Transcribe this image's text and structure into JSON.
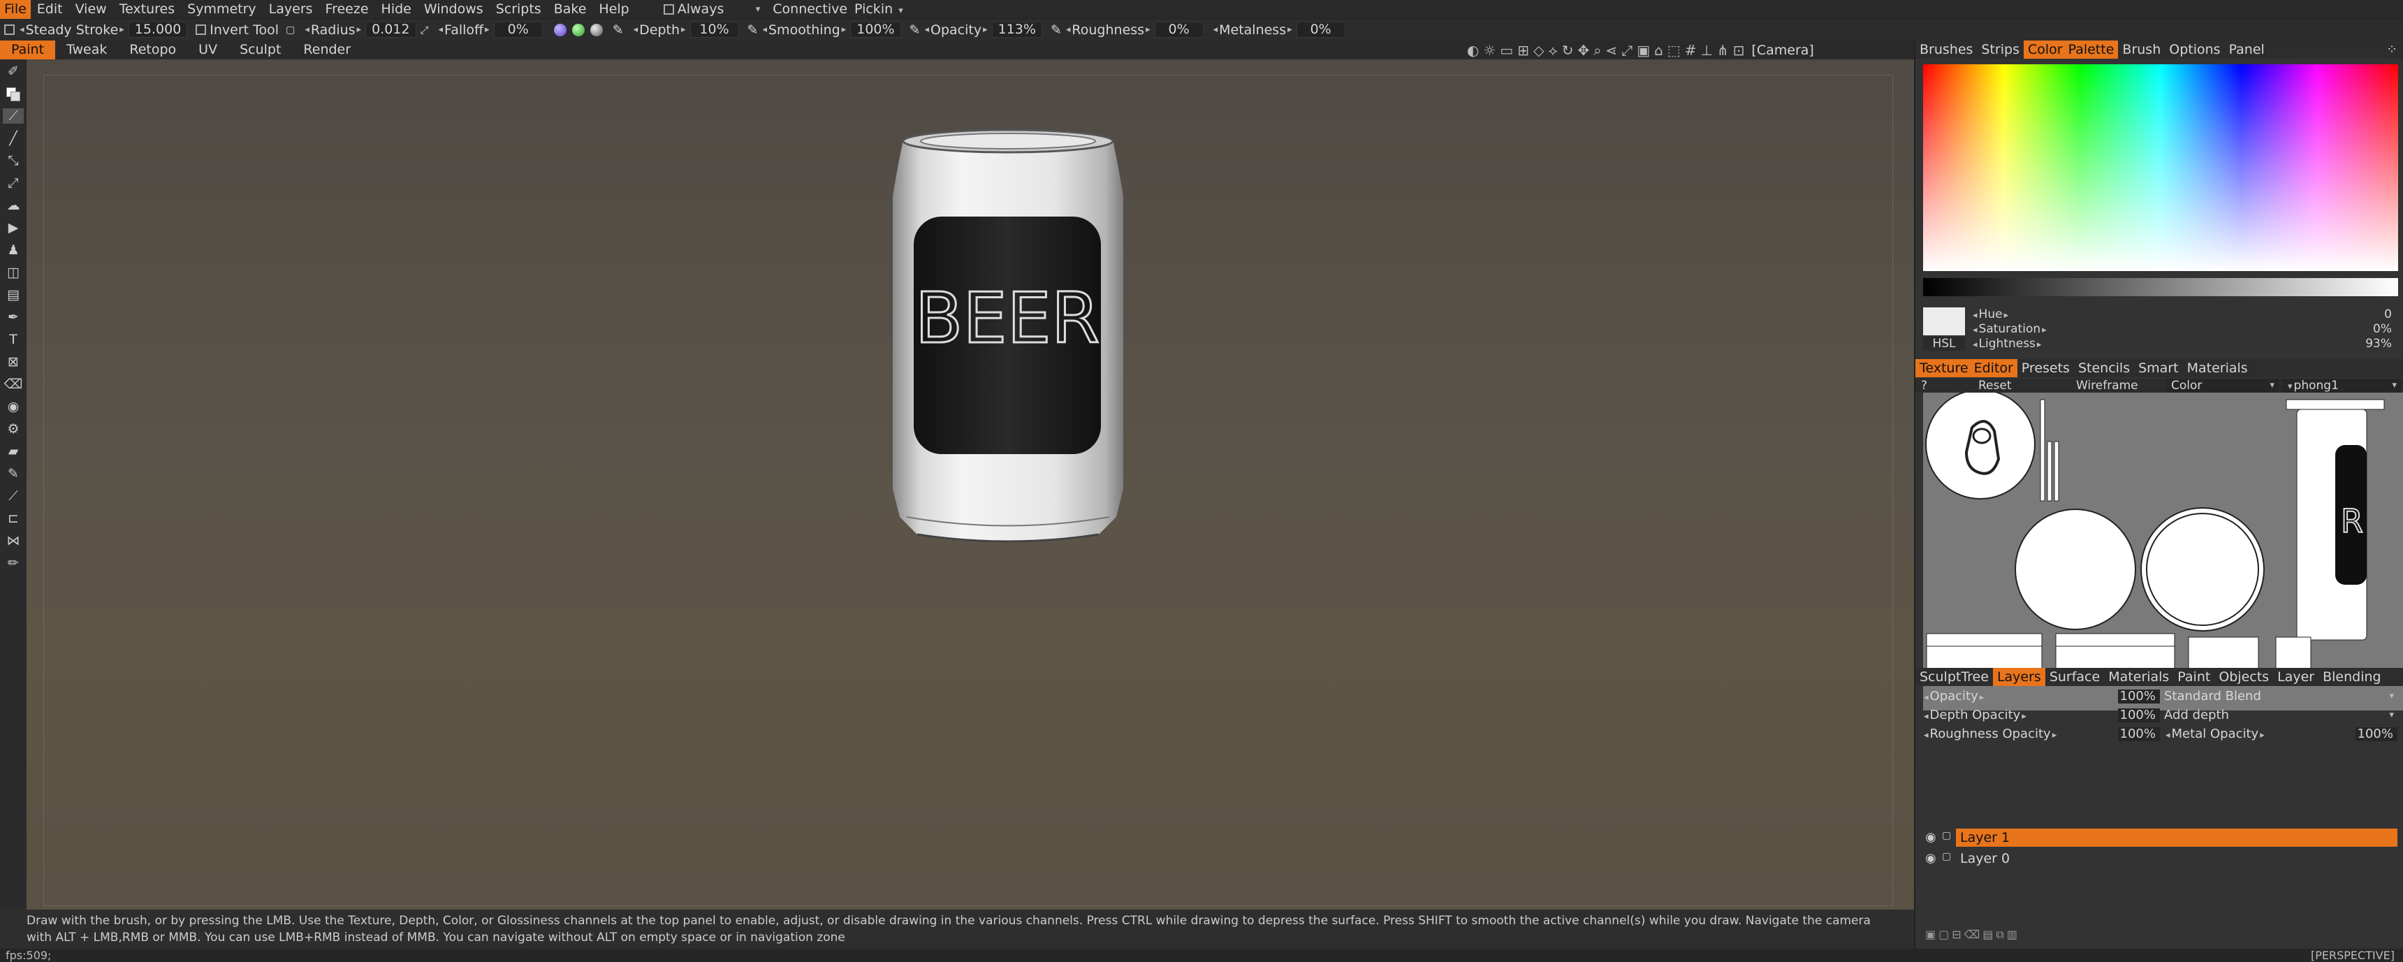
{
  "menubar": {
    "items": [
      "File",
      "Edit",
      "View",
      "Textures",
      "Symmetry",
      "Layers",
      "Freeze",
      "Hide",
      "Windows",
      "Scripts",
      "Bake",
      "Help"
    ],
    "always_label": "Always",
    "connective_label": "Connective",
    "pickin_label": "Pickin"
  },
  "toolopts": {
    "steady_stroke_label": "Steady Stroke",
    "steady_stroke_value": "15.000",
    "invert_tool_label": "Invert Tool",
    "radius_label": "Radius",
    "radius_value": "0.012",
    "falloff_label": "Falloff",
    "falloff_value": "0%",
    "depth_label": "Depth",
    "depth_value": "10%",
    "smoothing_label": "Smoothing",
    "smoothing_value": "100%",
    "opacity_label": "Opacity",
    "opacity_value": "113%",
    "roughness_label": "Roughness",
    "roughness_value": "0%",
    "metalness_label": "Metalness",
    "metalness_value": "0%"
  },
  "modebar": {
    "tabs": [
      "Paint",
      "Tweak",
      "Retopo",
      "UV",
      "Sculpt",
      "Render"
    ],
    "camera_label": "[Camera]"
  },
  "viewport": {
    "can_label": "BEER"
  },
  "hint_text": "Draw with the brush, or by pressing the LMB. Use the Texture, Depth, Color, or Glossiness channels at the top panel to enable, adjust, or disable drawing in the various channels. Press CTRL while drawing to depress the surface. Press SHIFT to smooth the active channel(s) while you draw. Navigate the camera with ALT + LMB,RMB or MMB. You can use LMB+RMB instead of MMB. You can navigate without ALT on empty space or in navigation zone",
  "statusbar": {
    "fps": "fps:509;",
    "perspective": "[PERSPECTIVE]"
  },
  "colorpanel": {
    "tabs": [
      "Brushes",
      "Strips",
      "Color",
      "Palette",
      "Brush",
      "Options",
      "Panel"
    ],
    "hsl_label": "HSL",
    "hue_label": "Hue",
    "hue_value": "0",
    "saturation_label": "Saturation",
    "saturation_value": "0%",
    "lightness_label": "Lightness",
    "lightness_value": "93%"
  },
  "texeditor": {
    "tabs": [
      "Texture",
      "Editor",
      "Presets",
      "Stencils",
      "Smart",
      "Materials"
    ],
    "help": "?",
    "reset": "Reset",
    "wireframe": "Wireframe",
    "channel": "Color",
    "material": "phong1"
  },
  "layerspanel": {
    "tabs": [
      "SculptTree",
      "Layers",
      "Surface",
      "Materials",
      "Paint",
      "Objects",
      "Layer",
      "Blending"
    ],
    "opacity_label": "Opacity",
    "opacity_value": "100%",
    "blend_mode": "Standard Blend",
    "depth_opacity_label": "Depth Opacity",
    "depth_opacity_value": "100%",
    "add_depth": "Add depth",
    "roughness_opacity_label": "Roughness Opacity",
    "roughness_opacity_value": "100%",
    "metal_opacity_label": "Metal Opacity",
    "metal_opacity_value": "100%",
    "layers": [
      "Layer 1",
      "Layer 0"
    ]
  }
}
